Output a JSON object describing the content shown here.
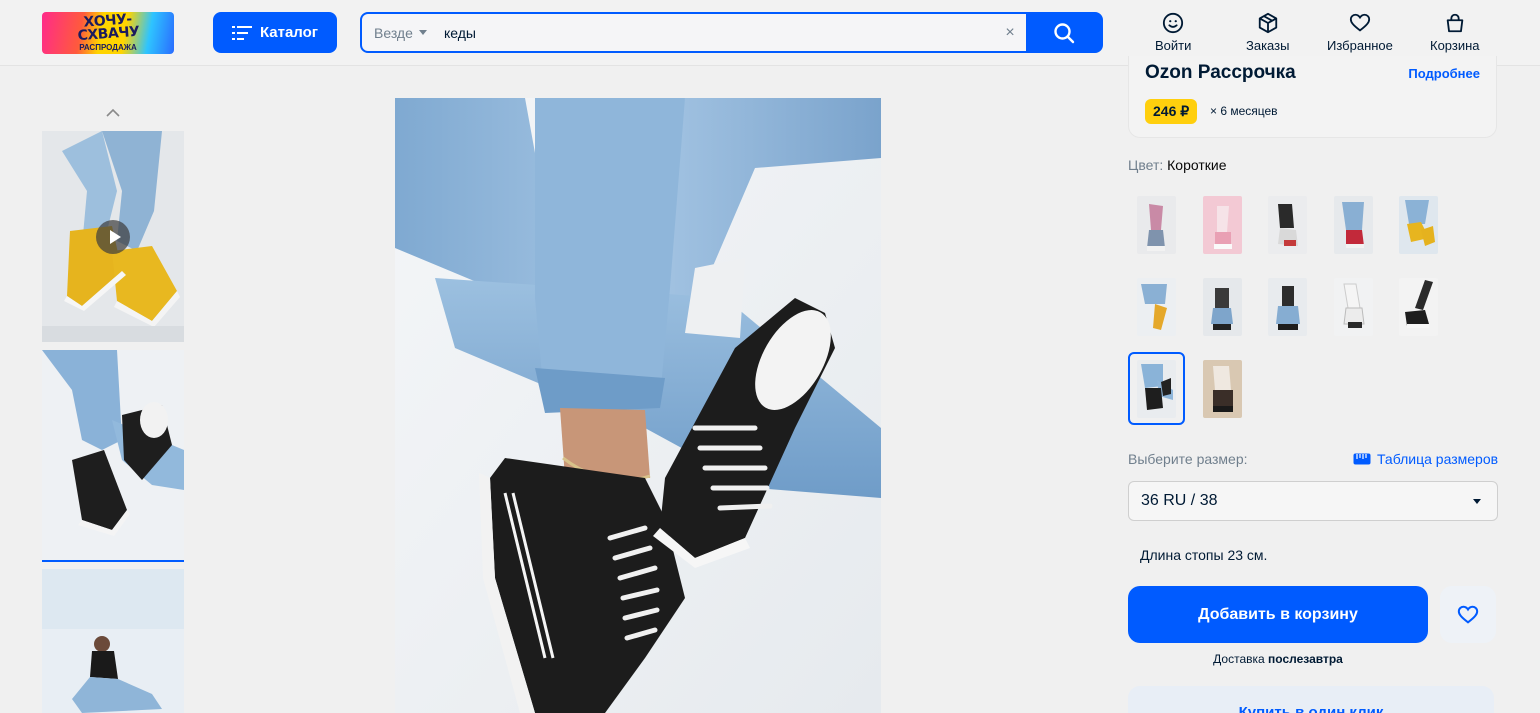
{
  "header": {
    "logo": {
      "line1": "ХОЧУ-",
      "line2": "СХВАЧУ",
      "sub": "РАСПРОДАЖА"
    },
    "catalog_label": "Каталог",
    "search": {
      "scope": "Везде",
      "value": "кеды",
      "clear": "×"
    },
    "nav": [
      {
        "label": "Войти",
        "icon": "smiley-icon"
      },
      {
        "label": "Заказы",
        "icon": "box-icon"
      },
      {
        "label": "Избранное",
        "icon": "heart-icon"
      },
      {
        "label": "Корзина",
        "icon": "bag-icon"
      }
    ]
  },
  "installment": {
    "title": "Ozon Рассрочка",
    "more": "Подробнее",
    "amount": "246 ₽",
    "term": "× 6 месяцев"
  },
  "color": {
    "label": "Цвет:",
    "value": "Короткие",
    "swatch_count": 12,
    "selected_index": 10
  },
  "size": {
    "label": "Выберите размер:",
    "table_link": "Таблица размеров",
    "selected": "36 RU / 38",
    "foot_length": "Длина стопы 23 см."
  },
  "actions": {
    "add_to_cart": "Добавить в корзину",
    "delivery_prefix": "Доставка",
    "delivery_day": "послезавтра",
    "one_click": "Купить в один клик"
  },
  "colors": {
    "accent": "#005bff",
    "installment_badge": "#ffcf0d"
  }
}
